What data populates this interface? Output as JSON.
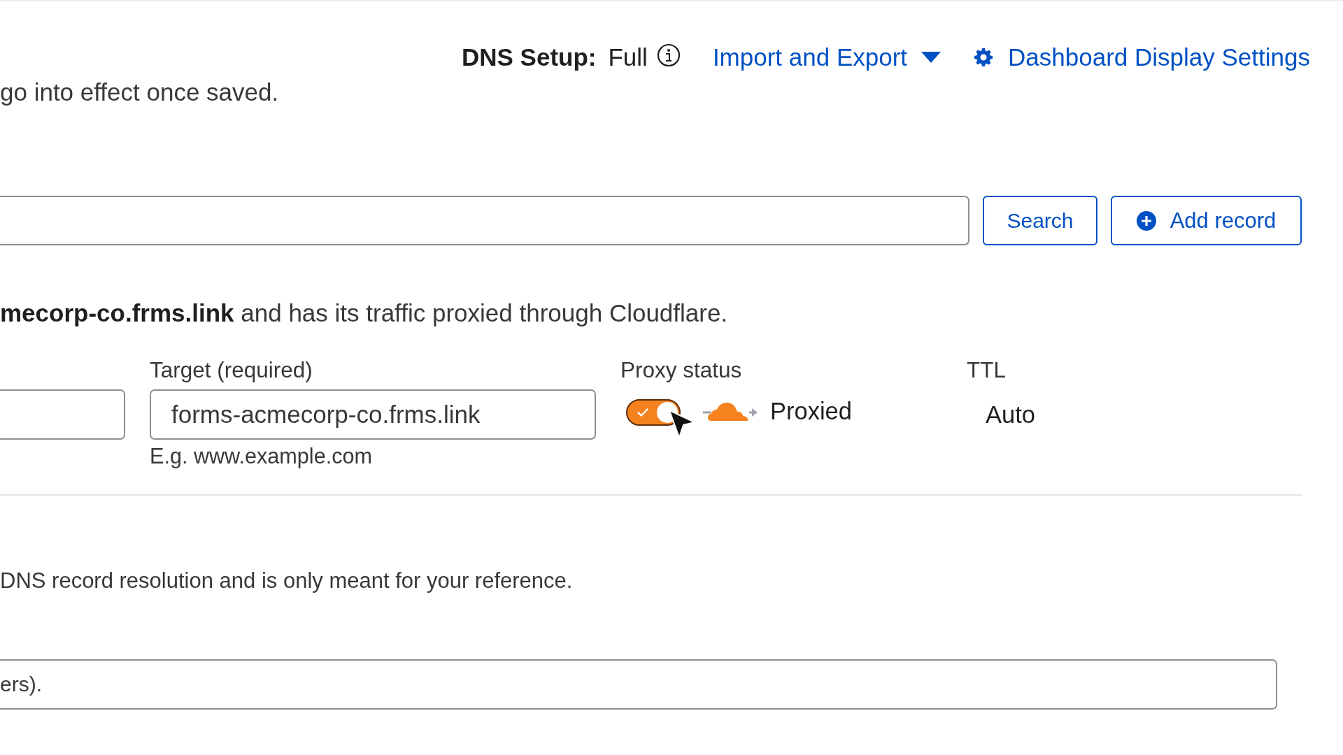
{
  "header": {
    "dns_setup": {
      "label": "DNS Setup:",
      "value": "Full"
    },
    "links": [
      {
        "kind": "dropdown",
        "label": "Import and Export"
      },
      {
        "kind": "settings",
        "label": "Dashboard Display Settings"
      }
    ],
    "notice": "go into effect once saved."
  },
  "search_bar": {
    "buttons": [
      {
        "kind": "plain",
        "label": "Search"
      },
      {
        "kind": "add",
        "label": "Add record"
      }
    ]
  },
  "record_form": {
    "notice": "**mecorp-co.frms.link** and has its traffic proxied through Cloudflare.",
    "target": {
      "label": "Target (required)",
      "value": "forms-acmecorp-co.frms.link",
      "hint": "E.g. www.example.com"
    },
    "proxy": {
      "label": "Proxy status",
      "on": true,
      "status": "Proxied"
    },
    "ttl": {
      "label": "TTL",
      "value": "Auto"
    }
  },
  "comment": {
    "notice": "DNS record resolution and is only meant for your reference.",
    "placeholder": "ers)."
  }
}
